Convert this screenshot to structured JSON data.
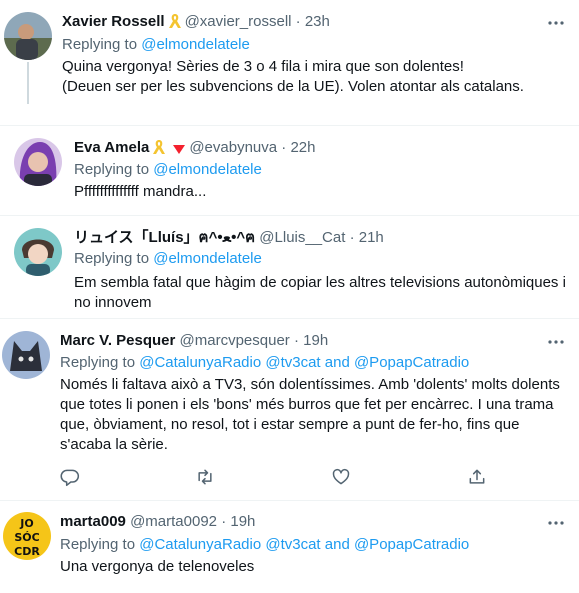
{
  "tweets": [
    {
      "name": "Xavier Rossell",
      "handle": "@xavier_rossell",
      "time": "23h",
      "replying_label": "Replying to",
      "replying_to": "@elmondelatele",
      "text_line1": "Quina vergonya! Sèries de 3 o 4 fila i mira que son dolentes!",
      "text_line2": "(Deuen ser per les subvencions de la UE). Volen atontar als catalans."
    },
    {
      "name": "Eva Amela",
      "handle": "@evabynuva",
      "time": "22h",
      "replying_label": "Replying to",
      "replying_to": "@elmondelatele",
      "text_line1": "Pffffffffffffff mandra..."
    },
    {
      "name": "リュイス「Lluís」ฅ^•ﻌ•^ฅ",
      "handle": "@Lluis__Cat",
      "time": "21h",
      "replying_label": "Replying to",
      "replying_to": "@elmondelatele",
      "text_line1": "Em sembla fatal que hàgim de copiar les altres televisions autonòmiques i",
      "text_line2": "no innovem"
    },
    {
      "name": "Marc V. Pesquer",
      "handle": "@marcvpesquer",
      "time": "19h",
      "replying_label": "Replying to",
      "replying_to": "@CatalunyaRadio @tv3cat and @PopapCatradio",
      "text_line1": "Només li faltava això a TV3, són dolentíssimes. Amb 'dolents' molts dolents",
      "text_line2": "que totes li ponen i els 'bons' més burros que fet per encàrrec. I una trama",
      "text_line3": "que, òbviament, no resol, tot i estar sempre a punt de fer-ho, fins que",
      "text_line4": "s'acaba la sèrie."
    },
    {
      "name": "marta009",
      "handle": "@marta0092",
      "time": "19h",
      "replying_label": "Replying to",
      "replying_to": "@CatalunyaRadio @tv3cat and @PopapCatradio",
      "text_line1": "Una vergonya de telenoveles",
      "avatar_text_l1": "JO",
      "avatar_text_l2": "SÓC",
      "avatar_text_l3": "CDR"
    }
  ],
  "dot": "·",
  "colors": {
    "link": "#1d9bf0",
    "secondary_text": "#536471",
    "ribbon": "#f4c430",
    "triangle": "#f4212e"
  },
  "icons": [
    "more-icon",
    "yellow-ribbon-icon",
    "red-triangle-icon",
    "reply-icon",
    "retweet-icon",
    "like-icon",
    "share-icon"
  ]
}
